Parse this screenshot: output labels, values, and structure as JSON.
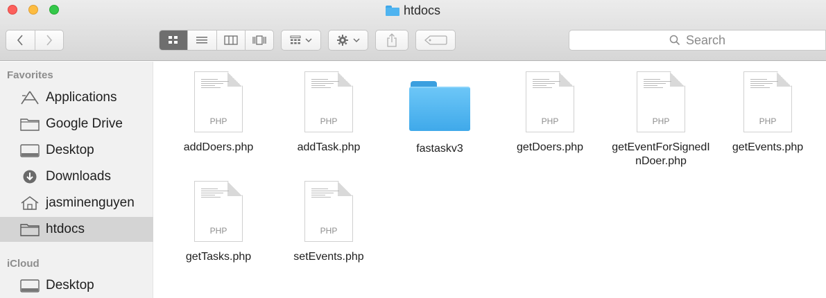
{
  "window": {
    "title": "htdocs"
  },
  "toolbar": {
    "back_icon": "chevron-left-icon",
    "forward_icon": "chevron-right-icon",
    "view_modes": [
      "icon-view",
      "list-view",
      "column-view",
      "cover-flow-view"
    ],
    "active_view": "icon-view",
    "search": {
      "placeholder": "Search",
      "value": ""
    }
  },
  "sidebar": {
    "sections": [
      {
        "title": "Favorites",
        "items": [
          {
            "label": "Applications",
            "icon": "applications-icon",
            "selected": false
          },
          {
            "label": "Google Drive",
            "icon": "folder-icon",
            "selected": false
          },
          {
            "label": "Desktop",
            "icon": "desktop-icon",
            "selected": false
          },
          {
            "label": "Downloads",
            "icon": "downloads-icon",
            "selected": false
          },
          {
            "label": "jasminenguyen",
            "icon": "home-icon",
            "selected": false
          },
          {
            "label": "htdocs",
            "icon": "folder-icon",
            "selected": true
          }
        ]
      },
      {
        "title": "iCloud",
        "items": [
          {
            "label": "Desktop",
            "icon": "desktop-icon",
            "selected": false
          }
        ]
      }
    ]
  },
  "files": [
    {
      "name": "addDoers.php",
      "kind": "php",
      "ext_label": "PHP"
    },
    {
      "name": "addTask.php",
      "kind": "php",
      "ext_label": "PHP"
    },
    {
      "name": "fastaskv3",
      "kind": "folder",
      "ext_label": ""
    },
    {
      "name": "getDoers.php",
      "kind": "php",
      "ext_label": "PHP"
    },
    {
      "name": "getEventForSignedInDoer.php",
      "kind": "php",
      "ext_label": "PHP"
    },
    {
      "name": "getEvents.php",
      "kind": "php",
      "ext_label": "PHP"
    },
    {
      "name": "getTasks.php",
      "kind": "php",
      "ext_label": "PHP"
    },
    {
      "name": "setEvents.php",
      "kind": "php",
      "ext_label": "PHP"
    }
  ],
  "colors": {
    "accent_folder": "#4fb4f0",
    "selected_row": "#d4d4d4",
    "close": "#fc605c",
    "minimize": "#fdbc40",
    "zoom": "#34c84a"
  }
}
